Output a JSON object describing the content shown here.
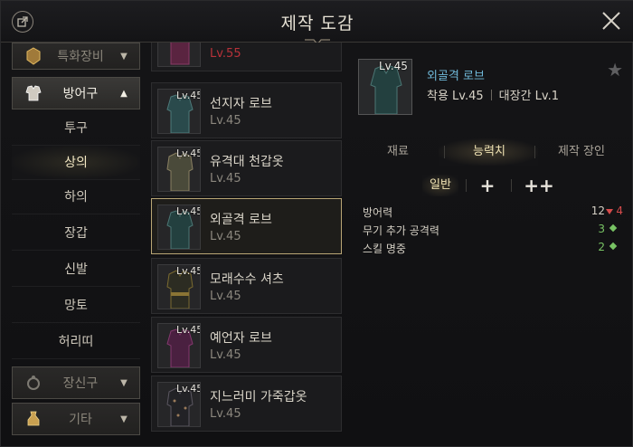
{
  "header": {
    "title": "제작 도감"
  },
  "sidebar": {
    "categories": [
      {
        "label": "특화장비",
        "icon": "special-gear-icon",
        "state": "collapsed"
      },
      {
        "label": "방어구",
        "icon": "armor-icon",
        "state": "expanded"
      },
      {
        "label": "장신구",
        "icon": "ring-icon",
        "state": "collapsed"
      },
      {
        "label": "기타",
        "icon": "bag-icon",
        "state": "collapsed"
      }
    ],
    "sub_items": [
      "투구",
      "상의",
      "하의",
      "장갑",
      "신발",
      "망토",
      "허리띠"
    ],
    "selected_sub_item": "상의"
  },
  "item_list": [
    {
      "level_badge": "",
      "name": "",
      "level": "Lv.55",
      "locked": true
    },
    {
      "level_badge": "Lv.45",
      "name": "선지자 로브",
      "level": "Lv.45"
    },
    {
      "level_badge": "Lv.45",
      "name": "유격대 천갑옷",
      "level": "Lv.45"
    },
    {
      "level_badge": "Lv.45",
      "name": "외골격 로브",
      "level": "Lv.45",
      "selected": true
    },
    {
      "level_badge": "Lv.45",
      "name": "모래수수 셔츠",
      "level": "Lv.45"
    },
    {
      "level_badge": "Lv.45",
      "name": "예언자 로브",
      "level": "Lv.45"
    },
    {
      "level_badge": "Lv.45",
      "name": "지느러미 가죽갑옷",
      "level": "Lv.45"
    }
  ],
  "detail": {
    "level_badge": "Lv.45",
    "name": "외골격 로브",
    "wear_level": "착용 Lv.45",
    "craftsman_level": "대장간 Lv.1",
    "tabs": [
      "재료",
      "능력치",
      "제작 장인"
    ],
    "active_tab": "능력치",
    "subtabs": [
      "일반",
      "+",
      "++"
    ],
    "active_subtab": "일반",
    "stats": [
      {
        "label": "방어력",
        "value": "12",
        "delta": "4",
        "delta_direction": "down"
      },
      {
        "label": "무기 추가 공격력",
        "value": "3",
        "indicator": "green-diamond"
      },
      {
        "label": "스킬 명중",
        "value": "2",
        "indicator": "green-diamond"
      }
    ]
  },
  "colors": {
    "item_name_link": "#6fb8d8",
    "selected_border": "#b9a675",
    "stat_down": "#d64b4b",
    "stat_green": "#78c364"
  }
}
